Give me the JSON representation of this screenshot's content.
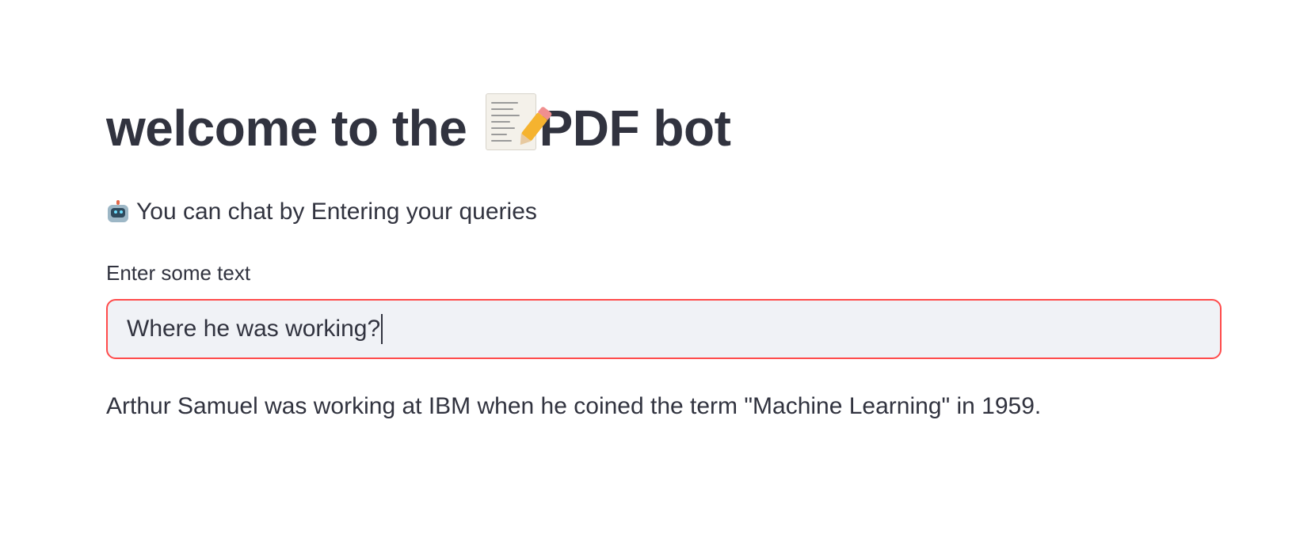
{
  "header": {
    "title_prefix": "welcome to the ",
    "title_emoji_icon": "memo-icon",
    "title_suffix": "PDF bot"
  },
  "subtitle": {
    "icon": "robot-icon",
    "text": "You can chat by Entering your queries"
  },
  "query_input": {
    "label": "Enter some text",
    "value": "Where he was working?"
  },
  "response": {
    "text": "Arthur Samuel was working at IBM when he coined the term \"Machine Learning\" in 1959."
  },
  "colors": {
    "text": "#31333f",
    "input_focus_border": "#ff4b4b",
    "input_background": "#f0f2f6"
  }
}
